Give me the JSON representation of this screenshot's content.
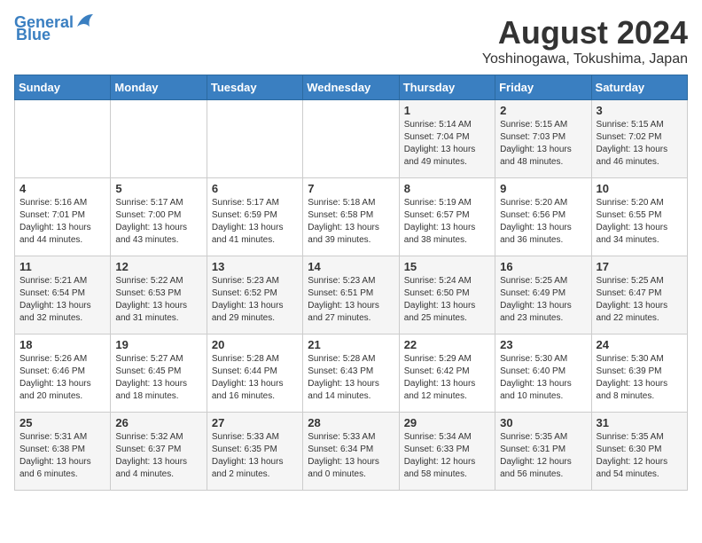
{
  "logo": {
    "line1": "General",
    "line2": "Blue"
  },
  "title": "August 2024",
  "subtitle": "Yoshinogawa, Tokushima, Japan",
  "days_of_week": [
    "Sunday",
    "Monday",
    "Tuesday",
    "Wednesday",
    "Thursday",
    "Friday",
    "Saturday"
  ],
  "weeks": [
    [
      {
        "day": "",
        "detail": ""
      },
      {
        "day": "",
        "detail": ""
      },
      {
        "day": "",
        "detail": ""
      },
      {
        "day": "",
        "detail": ""
      },
      {
        "day": "1",
        "detail": "Sunrise: 5:14 AM\nSunset: 7:04 PM\nDaylight: 13 hours\nand 49 minutes."
      },
      {
        "day": "2",
        "detail": "Sunrise: 5:15 AM\nSunset: 7:03 PM\nDaylight: 13 hours\nand 48 minutes."
      },
      {
        "day": "3",
        "detail": "Sunrise: 5:15 AM\nSunset: 7:02 PM\nDaylight: 13 hours\nand 46 minutes."
      }
    ],
    [
      {
        "day": "4",
        "detail": "Sunrise: 5:16 AM\nSunset: 7:01 PM\nDaylight: 13 hours\nand 44 minutes."
      },
      {
        "day": "5",
        "detail": "Sunrise: 5:17 AM\nSunset: 7:00 PM\nDaylight: 13 hours\nand 43 minutes."
      },
      {
        "day": "6",
        "detail": "Sunrise: 5:17 AM\nSunset: 6:59 PM\nDaylight: 13 hours\nand 41 minutes."
      },
      {
        "day": "7",
        "detail": "Sunrise: 5:18 AM\nSunset: 6:58 PM\nDaylight: 13 hours\nand 39 minutes."
      },
      {
        "day": "8",
        "detail": "Sunrise: 5:19 AM\nSunset: 6:57 PM\nDaylight: 13 hours\nand 38 minutes."
      },
      {
        "day": "9",
        "detail": "Sunrise: 5:20 AM\nSunset: 6:56 PM\nDaylight: 13 hours\nand 36 minutes."
      },
      {
        "day": "10",
        "detail": "Sunrise: 5:20 AM\nSunset: 6:55 PM\nDaylight: 13 hours\nand 34 minutes."
      }
    ],
    [
      {
        "day": "11",
        "detail": "Sunrise: 5:21 AM\nSunset: 6:54 PM\nDaylight: 13 hours\nand 32 minutes."
      },
      {
        "day": "12",
        "detail": "Sunrise: 5:22 AM\nSunset: 6:53 PM\nDaylight: 13 hours\nand 31 minutes."
      },
      {
        "day": "13",
        "detail": "Sunrise: 5:23 AM\nSunset: 6:52 PM\nDaylight: 13 hours\nand 29 minutes."
      },
      {
        "day": "14",
        "detail": "Sunrise: 5:23 AM\nSunset: 6:51 PM\nDaylight: 13 hours\nand 27 minutes."
      },
      {
        "day": "15",
        "detail": "Sunrise: 5:24 AM\nSunset: 6:50 PM\nDaylight: 13 hours\nand 25 minutes."
      },
      {
        "day": "16",
        "detail": "Sunrise: 5:25 AM\nSunset: 6:49 PM\nDaylight: 13 hours\nand 23 minutes."
      },
      {
        "day": "17",
        "detail": "Sunrise: 5:25 AM\nSunset: 6:47 PM\nDaylight: 13 hours\nand 22 minutes."
      }
    ],
    [
      {
        "day": "18",
        "detail": "Sunrise: 5:26 AM\nSunset: 6:46 PM\nDaylight: 13 hours\nand 20 minutes."
      },
      {
        "day": "19",
        "detail": "Sunrise: 5:27 AM\nSunset: 6:45 PM\nDaylight: 13 hours\nand 18 minutes."
      },
      {
        "day": "20",
        "detail": "Sunrise: 5:28 AM\nSunset: 6:44 PM\nDaylight: 13 hours\nand 16 minutes."
      },
      {
        "day": "21",
        "detail": "Sunrise: 5:28 AM\nSunset: 6:43 PM\nDaylight: 13 hours\nand 14 minutes."
      },
      {
        "day": "22",
        "detail": "Sunrise: 5:29 AM\nSunset: 6:42 PM\nDaylight: 13 hours\nand 12 minutes."
      },
      {
        "day": "23",
        "detail": "Sunrise: 5:30 AM\nSunset: 6:40 PM\nDaylight: 13 hours\nand 10 minutes."
      },
      {
        "day": "24",
        "detail": "Sunrise: 5:30 AM\nSunset: 6:39 PM\nDaylight: 13 hours\nand 8 minutes."
      }
    ],
    [
      {
        "day": "25",
        "detail": "Sunrise: 5:31 AM\nSunset: 6:38 PM\nDaylight: 13 hours\nand 6 minutes."
      },
      {
        "day": "26",
        "detail": "Sunrise: 5:32 AM\nSunset: 6:37 PM\nDaylight: 13 hours\nand 4 minutes."
      },
      {
        "day": "27",
        "detail": "Sunrise: 5:33 AM\nSunset: 6:35 PM\nDaylight: 13 hours\nand 2 minutes."
      },
      {
        "day": "28",
        "detail": "Sunrise: 5:33 AM\nSunset: 6:34 PM\nDaylight: 13 hours\nand 0 minutes."
      },
      {
        "day": "29",
        "detail": "Sunrise: 5:34 AM\nSunset: 6:33 PM\nDaylight: 12 hours\nand 58 minutes."
      },
      {
        "day": "30",
        "detail": "Sunrise: 5:35 AM\nSunset: 6:31 PM\nDaylight: 12 hours\nand 56 minutes."
      },
      {
        "day": "31",
        "detail": "Sunrise: 5:35 AM\nSunset: 6:30 PM\nDaylight: 12 hours\nand 54 minutes."
      }
    ]
  ]
}
